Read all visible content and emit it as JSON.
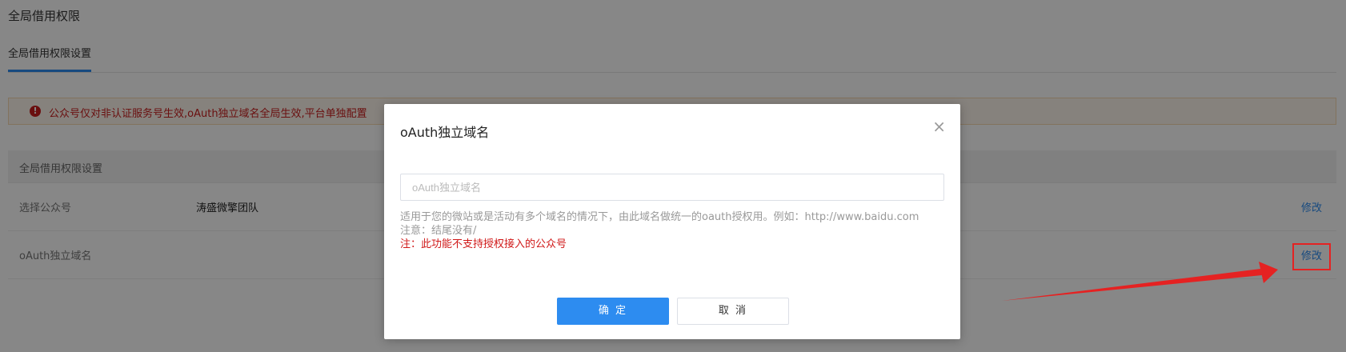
{
  "page": {
    "title": "全局借用权限",
    "tab_active": "全局借用权限设置"
  },
  "alert": {
    "icon": "alert-circle-icon",
    "text": "公众号仅对非认证服务号生效,oAuth独立域名全局生效,平台单独配置"
  },
  "section": {
    "header": "全局借用权限设置",
    "rows": [
      {
        "label": "选择公众号",
        "value": "涛盛微擎团队",
        "action": "修改"
      },
      {
        "label": "oAuth独立域名",
        "value": "",
        "action": "修改"
      }
    ]
  },
  "modal": {
    "title": "oAuth独立域名",
    "close_icon": "close-icon",
    "input_placeholder": "oAuth独立域名",
    "input_value": "",
    "help_line1": "适用于您的微站或是活动有多个域名的情况下，由此域名做统一的oauth授权用。例如：http://www.baidu.com",
    "help_line2": "注意：结尾没有/",
    "help_line3": "注：此功能不支持授权接入的公众号",
    "ok_label": "确 定",
    "cancel_label": "取 消"
  },
  "colors": {
    "accent": "#2d8cf0",
    "alert_text": "#c81e1e",
    "annotation": "#e52222"
  }
}
